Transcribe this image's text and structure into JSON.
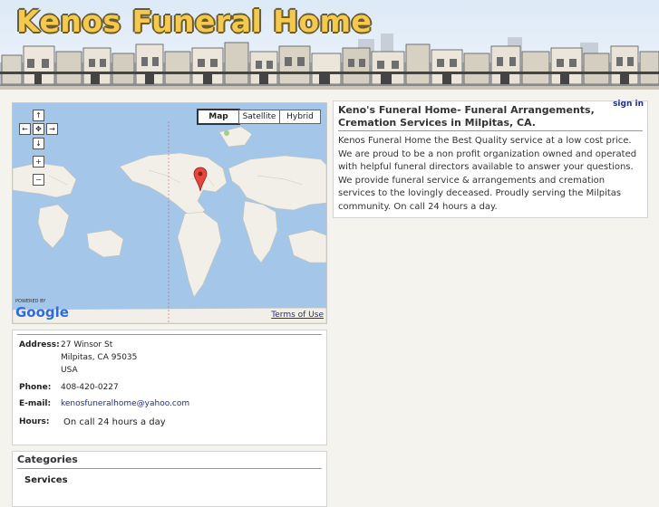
{
  "header": {
    "title": "Kenos Funeral Home"
  },
  "map": {
    "types": [
      "Map",
      "Satellite",
      "Hybrid"
    ],
    "selected_type": "Map",
    "powered_by": "POWERED BY",
    "google_logo": "Google",
    "terms_link": "Terms of Use"
  },
  "listing": {
    "sign_in": "sign in",
    "title": "Keno's Funeral Home- Funeral Arrangements, Cremation Services in Milpitas, CA.",
    "description": "Kenos Funeral Home the Best Quality service at a low cost price. We are proud to be a non profit organization owned and operated with helpful funeral directors available to answer your questions. We provide funeral service & arrangements and cremation services to the lovingly deceased. Proudly serving the Milpitas community. On call 24 hours a day."
  },
  "contact": {
    "address_label": "Address:",
    "address_line1": "27 Winsor St",
    "address_line2": "Milpitas, CA 95035",
    "address_line3": "USA",
    "phone_label": "Phone:",
    "phone": "408-420-0227",
    "email_label": "E-mail:",
    "email": "kenosfuneralhome@yahoo.com",
    "hours_label": "Hours:",
    "hours": "On call 24 hours a day"
  },
  "categories": {
    "heading": "Categories",
    "first": "Services"
  },
  "colors": {
    "title_fill": "#f4c94e",
    "title_outline": "#6b5a2c",
    "link": "#1f2e88",
    "ocean": "#a4c6e9",
    "land": "#f2efe9",
    "pin": "#e8453c"
  }
}
